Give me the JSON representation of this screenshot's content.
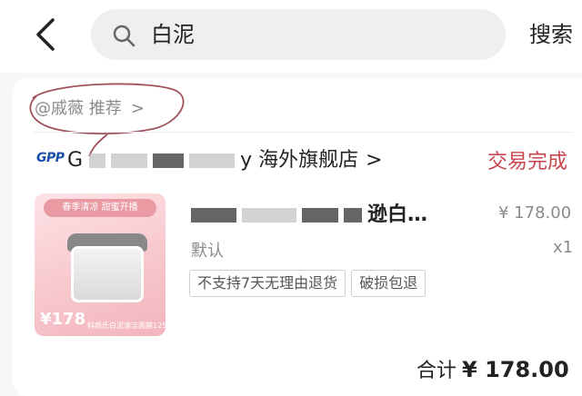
{
  "header": {
    "search_value": "白泥",
    "search_button": "搜索"
  },
  "card": {
    "recommend_text": "@戚薇 推荐",
    "recommend_chevron": ">",
    "store_logo": "GPP",
    "store_name_start": "G",
    "store_name_end": "y 海外旗舰店",
    "store_chevron": ">",
    "order_status": "交易完成",
    "product": {
      "image_banner": "春季清凉  甜蜜开播",
      "image_price": "¥178",
      "image_caption": "科颜氏白泥清洁面膜125ml",
      "title_end": "逊白…",
      "price": "¥ 178.00",
      "variant": "默认",
      "quantity": "x1",
      "tags": [
        "不支持7天无理由退货",
        "破损包退"
      ]
    },
    "total_label": "合计",
    "total_amount": "¥ 178.00"
  },
  "colors": {
    "status_red": "#c9464f",
    "background": "#f7f7f7",
    "search_bg": "#efefef"
  }
}
